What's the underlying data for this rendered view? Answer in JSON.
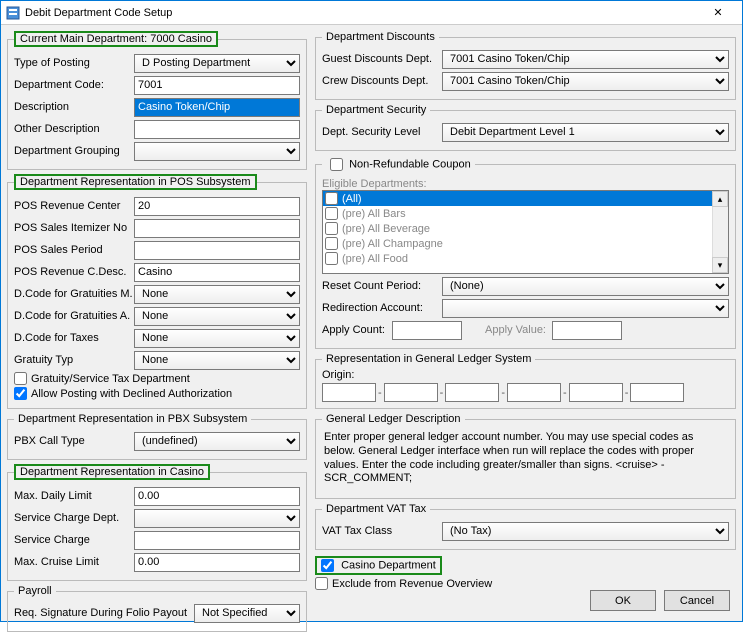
{
  "window": {
    "title": "Debit Department Code Setup",
    "close_label": "✕"
  },
  "main": {
    "legend": "Current Main Department: 7000 Casino",
    "type_of_posting_lbl": "Type of Posting",
    "type_of_posting_val": "D Posting Department",
    "dept_code_lbl": "Department Code:",
    "dept_code_val": "7001",
    "description_lbl": "Description",
    "description_val": "Casino Token/Chip",
    "other_desc_lbl": "Other Description",
    "other_desc_val": "",
    "dept_group_lbl": "Department Grouping",
    "dept_group_val": ""
  },
  "pos": {
    "legend": "Department Representation in POS Subsystem",
    "rev_center_lbl": "POS Revenue Center",
    "rev_center_val": "20",
    "sales_itemizer_lbl": "POS Sales Itemizer No",
    "sales_itemizer_val": "",
    "sales_period_lbl": "POS Sales Period",
    "sales_period_val": "",
    "rev_cdesc_lbl": "POS Revenue C.Desc.",
    "rev_cdesc_val": "Casino",
    "dcode_grat_m_lbl": "D.Code for Gratuities M.",
    "dcode_grat_m_val": "None",
    "dcode_grat_a_lbl": "D.Code for Gratuities A.",
    "dcode_grat_a_val": "None",
    "dcode_taxes_lbl": "D.Code for Taxes",
    "dcode_taxes_val": "None",
    "gratuity_typ_lbl": "Gratuity Typ",
    "gratuity_typ_val": "None",
    "grat_service_tax_lbl": "Gratuity/Service Tax Department",
    "allow_declined_lbl": "Allow Posting with Declined Authorization"
  },
  "pbx": {
    "legend": "Department Representation in PBX Subsystem",
    "call_type_lbl": "PBX Call Type",
    "call_type_val": "(undefined)"
  },
  "casino": {
    "legend": "Department Representation in Casino",
    "max_daily_lbl": "Max. Daily Limit",
    "max_daily_val": "0.00",
    "svc_charge_dept_lbl": "Service Charge Dept.",
    "svc_charge_dept_val": "",
    "svc_charge_lbl": "Service Charge",
    "svc_charge_val": "",
    "max_cruise_lbl": "Max. Cruise Limit",
    "max_cruise_val": "0.00"
  },
  "payroll": {
    "legend": "Payroll",
    "req_sig_lbl": "Req. Signature During Folio Payout",
    "req_sig_val": "Not Specified"
  },
  "discounts": {
    "legend": "Department Discounts",
    "guest_lbl": "Guest Discounts Dept.",
    "guest_val": "7001    Casino Token/Chip",
    "crew_lbl": "Crew Discounts Dept.",
    "crew_val": "7001    Casino Token/Chip"
  },
  "security": {
    "legend": "Department Security",
    "level_lbl": "Dept. Security Level",
    "level_val": "Debit Department Level 1"
  },
  "coupon": {
    "legend": "Non-Refundable Coupon",
    "eligible_lbl": "Eligible Departments:",
    "items": [
      "(All)",
      "(pre) All Bars",
      "(pre) All Beverage",
      "(pre) All Champagne",
      "(pre) All Food"
    ],
    "reset_lbl": "Reset Count Period:",
    "reset_val": "(None)",
    "redir_lbl": "Redirection Account:",
    "redir_val": "",
    "count_lbl": "Apply Count:",
    "count_val": "",
    "value_lbl": "Apply Value:",
    "value_val": ""
  },
  "gl": {
    "legend": "Representation in General Ledger System",
    "origin_lbl": "Origin:"
  },
  "gl_desc": {
    "legend": "General Ledger Description",
    "text": "Enter proper general ledger account number. You may use special codes as below. General Ledger interface when run will replace the codes with proper values. Enter the code including greater/smaller than signs. <cruise> - SCR_COMMENT;"
  },
  "vat": {
    "legend": "Department VAT Tax",
    "class_lbl": "VAT Tax Class",
    "class_val": "(No Tax)"
  },
  "flags": {
    "casino_dept_lbl": "Casino Department",
    "exclude_rev_lbl": "Exclude from Revenue Overview"
  },
  "buttons": {
    "ok": "OK",
    "cancel": "Cancel"
  }
}
